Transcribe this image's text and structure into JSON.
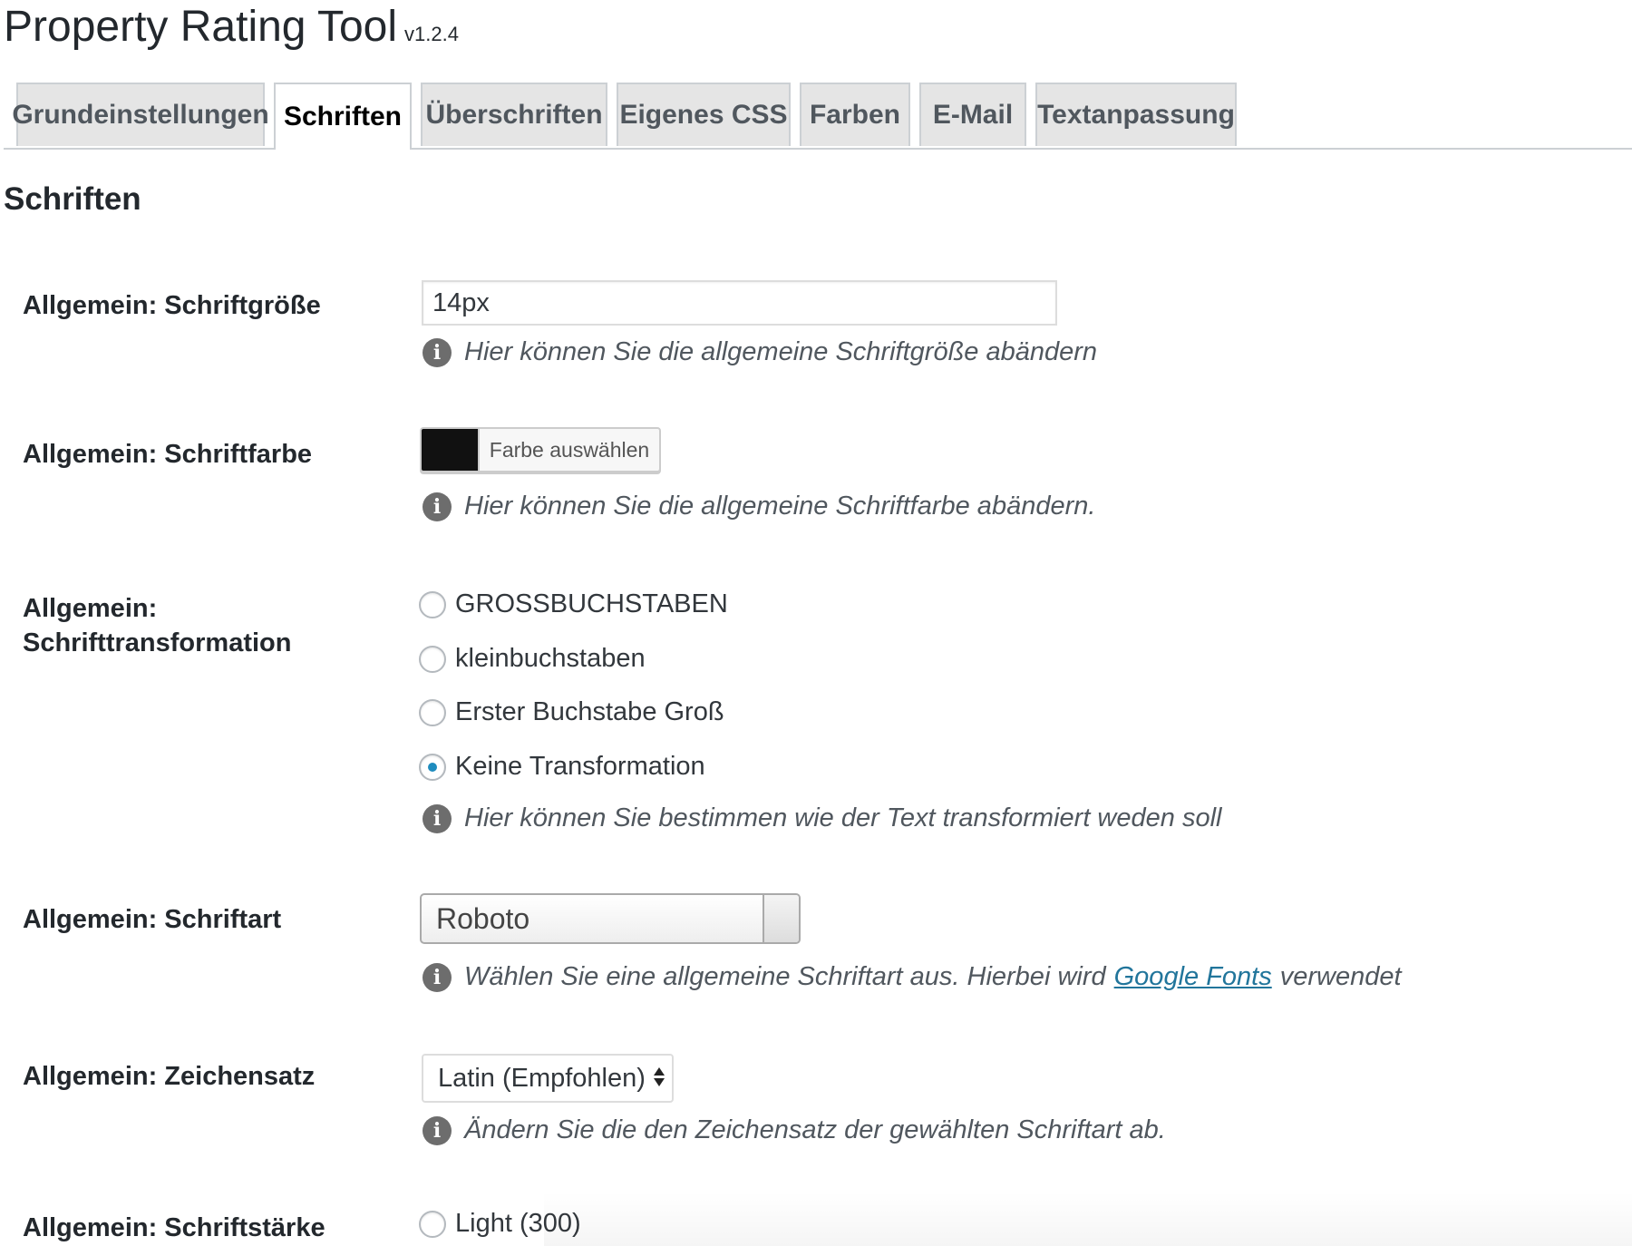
{
  "header": {
    "title": "Property Rating Tool",
    "version": "v1.2.4"
  },
  "tabs": [
    {
      "label": "Grundeinstellungen",
      "active": false
    },
    {
      "label": "Schriften",
      "active": true
    },
    {
      "label": "Überschriften",
      "active": false
    },
    {
      "label": "Eigenes CSS",
      "active": false
    },
    {
      "label": "Farben",
      "active": false
    },
    {
      "label": "E-Mail",
      "active": false
    },
    {
      "label": "Textanpassung",
      "active": false
    }
  ],
  "section": {
    "title": "Schriften"
  },
  "fields": {
    "font_size": {
      "label": "Allgemein: Schriftgröße",
      "value": "14px",
      "hint": "Hier können Sie die allgemeine Schriftgröße abändern"
    },
    "font_color": {
      "label": "Allgemein: Schriftfarbe",
      "button_label": "Farbe auswählen",
      "color": "#111111",
      "hint": "Hier können Sie die allgemeine Schriftfarbe abändern."
    },
    "text_transform": {
      "label_line1": "Allgemein:",
      "label_line2": "Schrifttransformation",
      "options": [
        {
          "label": "GROSSBUCHSTABEN",
          "checked": false
        },
        {
          "label": "kleinbuchstaben",
          "checked": false
        },
        {
          "label": "Erster Buchstabe Groß",
          "checked": false
        },
        {
          "label": "Keine Transformation",
          "checked": true
        }
      ],
      "hint": "Hier können Sie bestimmen wie der Text transformiert weden soll"
    },
    "font_family": {
      "label": "Allgemein: Schriftart",
      "value": "Roboto",
      "hint_before": "Wählen Sie eine allgemeine Schriftart aus. Hierbei wird",
      "hint_link": "Google Fonts",
      "hint_after": "verwendet"
    },
    "charset": {
      "label": "Allgemein: Zeichensatz",
      "value": "Latin (Empfohlen)",
      "hint": "Ändern Sie die den Zeichensatz der gewählten Schriftart ab."
    },
    "font_weight": {
      "label": "Allgemein: Schriftstärke",
      "options": [
        {
          "label": "Light (300)",
          "checked": false
        }
      ]
    }
  },
  "colors": {
    "link": "#21759b",
    "radio_checked": "#1e8cbe",
    "text": "#23282d"
  }
}
